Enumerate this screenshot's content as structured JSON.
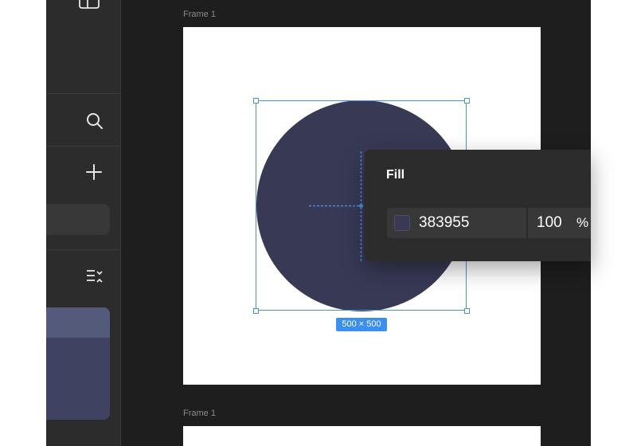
{
  "canvas": {
    "frames": [
      {
        "label": "Frame 1"
      },
      {
        "label": "Frame 1"
      }
    ]
  },
  "selection": {
    "size_label": "500 × 500"
  },
  "shape": {
    "type": "circle",
    "fill_color": "#383955"
  },
  "fill_panel": {
    "title": "Fill",
    "hex_value": "383955",
    "opacity_value": "100",
    "opacity_unit": "%"
  },
  "sidebar": {
    "icons": [
      "panel-icon",
      "search-icon",
      "plus-icon",
      "list-collapse-icon"
    ]
  },
  "colors": {
    "accent": "#3b8ff0",
    "canvas_bg": "#1e1e1e",
    "panel_bg": "#2c2c2c",
    "shape_fill": "#383955"
  }
}
